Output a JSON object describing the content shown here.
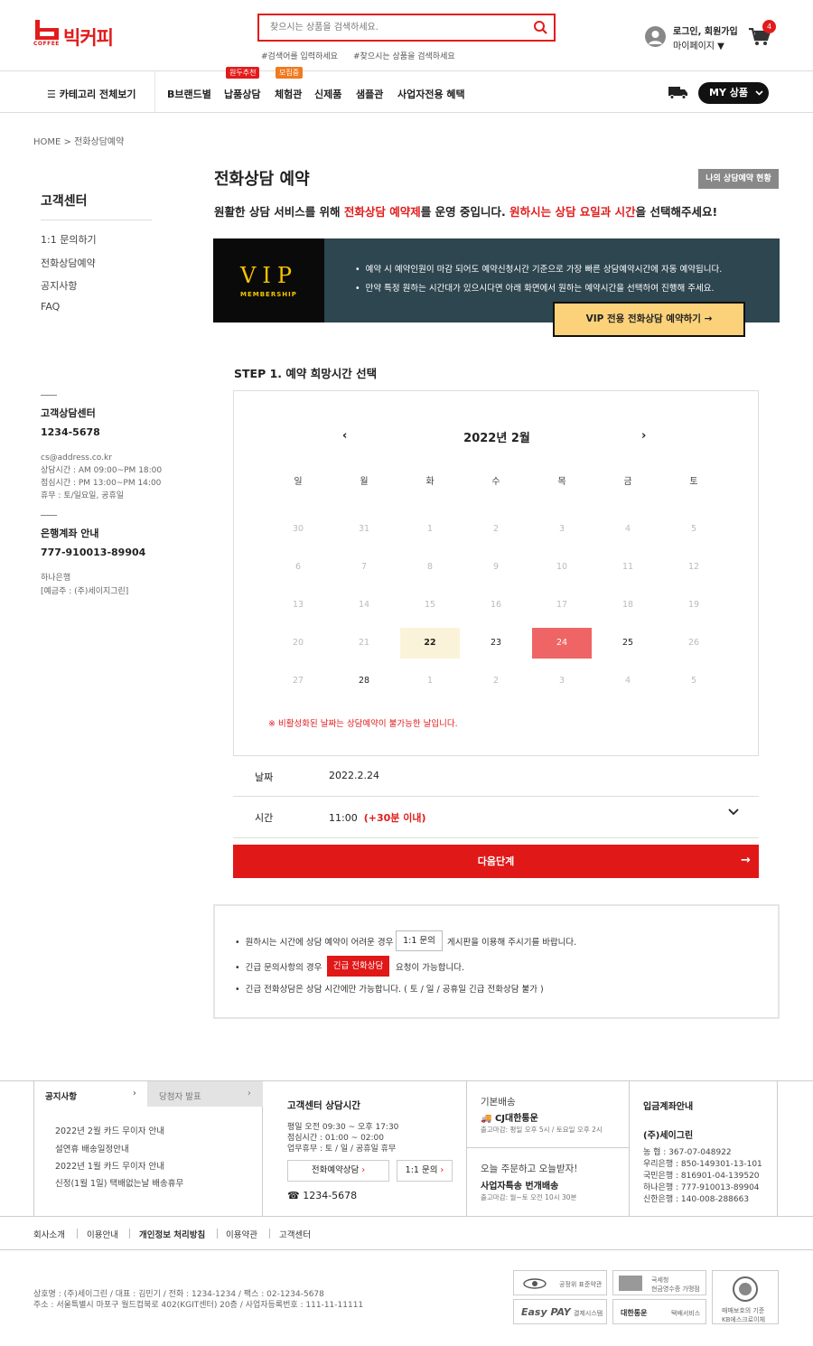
{
  "brand": {
    "logo_text": "빅커피",
    "logo_sub": "COFFEE",
    "accent": "#e31b1b"
  },
  "search": {
    "placeholder": "찾으시는 상품을 검색하세요.",
    "tag1": "#검색어를 입력하세요",
    "tag2": "#찾으시는 상품을 검색하세요"
  },
  "account": {
    "login": "로그인, 회원가입",
    "mypage": "마이페이지 ▼",
    "cart_count": "4"
  },
  "nav": {
    "category_all": "카테고리 전체보기",
    "items": [
      "B브랜드별",
      "납품상담",
      "체험관",
      "신제품",
      "샘플관",
      "사업자전용 혜택"
    ],
    "badge_delivery": "원두추천",
    "badge_recruit": "모집중",
    "my_products": "MY 상품"
  },
  "breadcrumb": {
    "home": "HOME",
    "current": "전화상담예약"
  },
  "sidebar": {
    "title": "고객센터",
    "items": [
      "1:1 문의하기",
      "전화상담예약",
      "공지사항",
      "FAQ"
    ],
    "center_title": "고객상담센터",
    "center_phone": "1234-5678",
    "center_email": "cs@address.co.kr",
    "center_hours": "상담시간 : AM 09:00~PM 18:00",
    "center_lunch": "점심시간 : PM 13:00~PM 14:00",
    "center_off": "휴무 : 토/일요일, 공휴일",
    "bank_title": "은행계좌 안내",
    "bank_number": "777-910013-89904",
    "bank_name": "하나은행",
    "bank_holder": "[예금주 : (주)세이지그린]"
  },
  "page": {
    "title": "전화상담 예약",
    "my_status_btn": "나의 상담예약 현황",
    "intro_a": "원활한 상담 서비스를 위해 ",
    "intro_b": "전화상담 예약제",
    "intro_c": "를 운영 중입니다. ",
    "intro_d": "원하시는 상담 요일과 시간",
    "intro_e": "을 선택해주세요!"
  },
  "vip": {
    "title": "VIP",
    "subtitle": "MEMBERSHIP",
    "bullet1": "예약 시 예약인원이 마감 되어도 예약신청시간 기준으로 가장 빠른 상담예약시간에 자동 예약됩니다.",
    "bullet2": "만약 특정 원하는 시간대가 있으시다면 아래 화면에서 원하는 예약시간을 선택하여 진행해 주세요.",
    "button": "VIP 전용 전화상담 예약하기 →"
  },
  "calendar": {
    "step": "STEP 1. 예약 희망시간 선택",
    "title": "2022년 2월",
    "prev": "‹",
    "next": "›",
    "weekdays": [
      "일",
      "월",
      "화",
      "수",
      "목",
      "금",
      "토"
    ],
    "weeks": [
      [
        "30",
        "31",
        "1",
        "2",
        "3",
        "4",
        "5"
      ],
      [
        "6",
        "7",
        "8",
        "9",
        "10",
        "11",
        "12"
      ],
      [
        "13",
        "14",
        "15",
        "16",
        "17",
        "18",
        "19"
      ],
      [
        "20",
        "21",
        "22",
        "23",
        "24",
        "25",
        "26"
      ],
      [
        "27",
        "28",
        "1",
        "2",
        "3",
        "4",
        "5"
      ]
    ],
    "note": "※ 비활성화된 날짜는 상담예약이 불가능한 날입니다."
  },
  "selection": {
    "date_label": "날짜",
    "date_value": "2022.2.24",
    "time_label": "시간",
    "time_value": "11:00",
    "time_extra": "(+30분 이내)"
  },
  "next_button": "다음단계",
  "notice": {
    "n1a": "원하시는 시간에 상담 예약이 어려운 경우",
    "n1btn": "1:1 문의",
    "n1b": "게시판을 이용해 주시기를 바랍니다.",
    "n2a": "긴급 문의사항의 경우",
    "n2btn": "긴급 전화상담",
    "n2b": "요청이 가능합니다.",
    "n3": "긴급 전화상담은 상담 시간에만 가능합니다. ( 토 / 일 / 공휴일 긴급 전화상담 불가 )"
  },
  "footer": {
    "tab1": "공지사항",
    "tab2": "당첨자 발표",
    "notices": [
      "2022년 2월 카드 무이자 안내",
      "설연휴 배송일정안내",
      "2022년 1월 카드 무이자 안내",
      "신정(1월 1일) 택배없는날 배송휴무"
    ],
    "cs_title": "고객센터 상담시간",
    "cs_l1": "평일 오전 09:30 ~ 오후 17:30",
    "cs_l2": "점심시간 : 01:00 ~ 02:00",
    "cs_l3": "업무휴무 : 토 / 일 / 공휴일 휴무",
    "cs_btn1": "전화예약상담",
    "cs_btn2": "1:1 문의",
    "cs_phone": "☎ 1234-5678",
    "ship_title": "기본배송",
    "ship_company": "CJ대한통운",
    "ship_cut": "출고마감: 평일 오후 5시 / 토요일 오후 2시",
    "ship2_title": "오늘 주문하고 오늘받자!",
    "ship2_name": "사업자특송 번개배송",
    "ship2_cut": "출고마감: 월~토 오전 10시 30분",
    "bank_title": "입금계좌안내",
    "bank_holder": "(주)세이그린",
    "banks": [
      "농      협 : 367-07-048922",
      "우리은행 : 850-149301-13-101",
      "국민은행 : 816901-04-139520",
      "하나은행 : 777-910013-89904",
      "신한은행 : 140-008-288663"
    ],
    "links": [
      "회사소개",
      "이용안내",
      "개인정보 처리방침",
      "이용약관",
      "고객센터"
    ],
    "addr1": "상호명 : (주)세이그린 / 대표 : 김민기 / 전화 : 1234-1234 / 팩스 : 02-1234-5678",
    "addr2": "주소 : 서울특별시 마포구 월드컵북로 402(KGIT센터) 20층 / 사업자등록번호 : 111-11-11111",
    "cert1": "공정위 표준약관",
    "cert2a": "국세청",
    "cert2b": "현금영수증 가맹점",
    "cert3": "결제시스템",
    "cert3logo": "Easy PAY",
    "cert4": "택배서비스",
    "cert4logo": "대한통운",
    "cert5a": "매매보호의 기준",
    "cert5b": "KB에스크로이체"
  }
}
